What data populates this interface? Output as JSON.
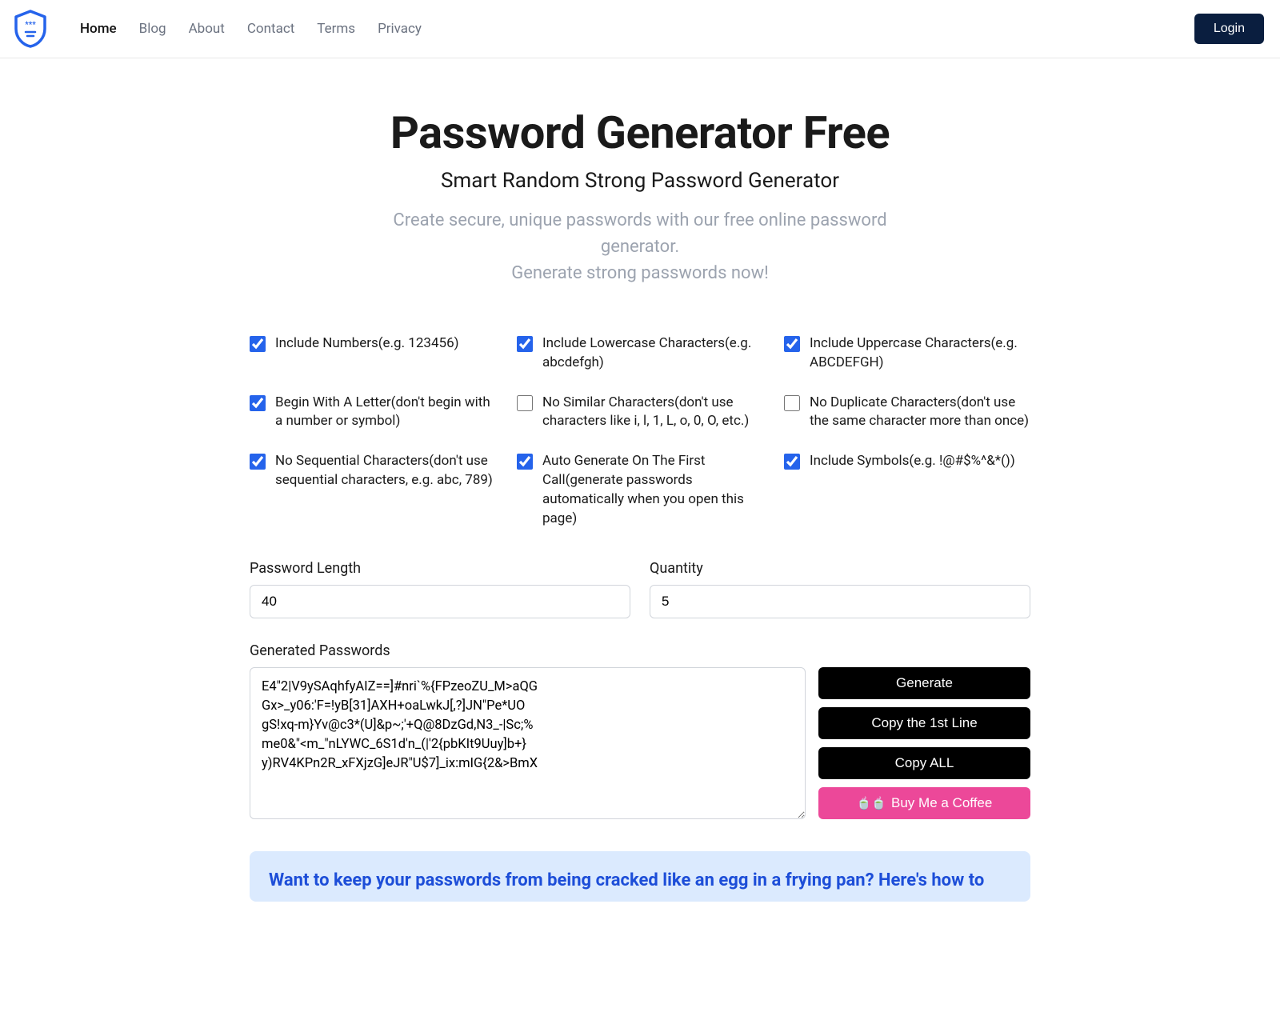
{
  "nav": {
    "items": [
      "Home",
      "Blog",
      "About",
      "Contact",
      "Terms",
      "Privacy"
    ],
    "active": "Home",
    "login": "Login"
  },
  "hero": {
    "title": "Password Generator Free",
    "subtitle": "Smart Random Strong Password Generator",
    "tagline1": "Create secure, unique passwords with our free online password generator.",
    "tagline2": "Generate strong passwords now!"
  },
  "options": [
    {
      "label": "Include Numbers(e.g. 123456)",
      "checked": true
    },
    {
      "label": "Include Lowercase Characters(e.g. abcdefgh)",
      "checked": true
    },
    {
      "label": "Include Uppercase Characters(e.g. ABCDEFGH)",
      "checked": true
    },
    {
      "label": "Begin With A Letter(don't begin with a number or symbol)",
      "checked": true
    },
    {
      "label": "No Similar Characters(don't use characters like i, l, 1, L, o, 0, O, etc.)",
      "checked": false
    },
    {
      "label": "No Duplicate Characters(don't use the same character more than once)",
      "checked": false
    },
    {
      "label": "No Sequential Characters(don't use sequential characters, e.g. abc, 789)",
      "checked": true
    },
    {
      "label": "Auto Generate On The First Call(generate passwords automatically when you open this page)",
      "checked": true
    },
    {
      "label": "Include Symbols(e.g. !@#$%^&*())",
      "checked": true
    }
  ],
  "fields": {
    "length_label": "Password Length",
    "length_value": "40",
    "quantity_label": "Quantity",
    "quantity_value": "5"
  },
  "generated": {
    "label": "Generated Passwords",
    "text": "E4\"2|V9ySAqhfyAIZ==]#nri`%{FPzeoZU_M>aQG\nGx>_y06:'F=!yB[31]AXH+oaLwkJ[,?]JN\"Pe*UO\ngS!xq-m}Yv@c3*(U]&p~;'+Q@8DzGd,N3_-|Sc;%\nme0&\"<m_\"nLYWC_6S1d'n_(|'2{pbKIt9Uuy]b+}\ny)RV4KPn2R_xFXjzG]eJR\"U$7]_ix:mIG{2&>BmX"
  },
  "buttons": {
    "generate": "Generate",
    "copy_first": "Copy the 1st Line",
    "copy_all": "Copy ALL",
    "coffee": "Buy Me a Coffee"
  },
  "promo": {
    "heading": "Want to keep your passwords from being cracked like an egg in a frying pan? Here's how to"
  }
}
